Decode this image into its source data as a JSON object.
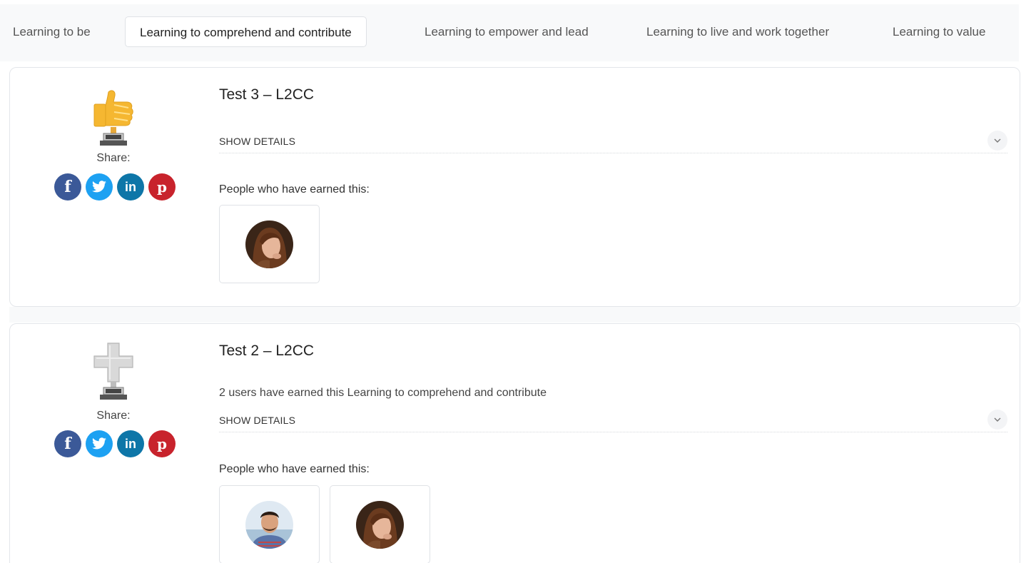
{
  "tabs": [
    {
      "label": "Learning to be",
      "active": false
    },
    {
      "label": "Learning to comprehend and contribute",
      "active": true
    },
    {
      "label": "Learning to empower and lead",
      "active": false
    },
    {
      "label": "Learning to live and work together",
      "active": false
    },
    {
      "label": "Learning to value",
      "active": false
    }
  ],
  "badges": [
    {
      "title": "Test 3 – L2CC",
      "earned_text": "",
      "icon": "thumbs-up-trophy-icon",
      "share_label": "Share:",
      "show_details_label": "SHOW DETAILS",
      "people_label": "People who have earned this:",
      "people": [
        "avatar-woman"
      ]
    },
    {
      "title": "Test 2 – L2CC",
      "earned_text": "2 users have earned this Learning to comprehend and contribute",
      "icon": "cross-trophy-icon",
      "share_label": "Share:",
      "show_details_label": "SHOW DETAILS",
      "people_label": "People who have earned this:",
      "people": [
        "avatar-man",
        "avatar-woman"
      ]
    }
  ],
  "social": {
    "facebook": "f",
    "linkedin": "in",
    "pinterest": "p"
  },
  "colors": {
    "facebook": "#3b5998",
    "twitter": "#1da1f2",
    "linkedin": "#0e76a8",
    "pinterest": "#c8232c",
    "thumb": "#f5b731"
  }
}
